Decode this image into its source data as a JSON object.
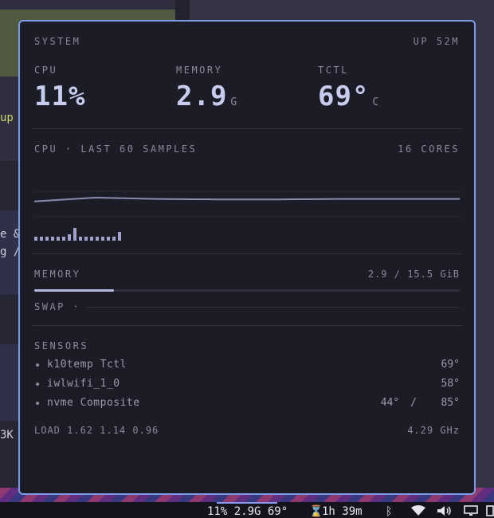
{
  "background": {
    "text_up": "up",
    "text_line1": "e &",
    "text_line2": "g /",
    "text_line3": "3K"
  },
  "statusbar": {
    "system": "11% 2.9G 69°",
    "hourglass_icon": "⌛",
    "time": "1h 39m",
    "bluetooth_icon": "ᛒ",
    "wifi_icon": "▼",
    "volume_icon": "🔊",
    "monitor_icon": "▭",
    "extra": "▯"
  },
  "popup": {
    "title": "SYSTEM",
    "uptime": "UP 52M",
    "stats": [
      {
        "label": "CPU",
        "value": "11%",
        "unit": ""
      },
      {
        "label": "MEMORY",
        "value": "2.9",
        "unit": "G"
      },
      {
        "label": "TCTL",
        "value": "69°",
        "unit": "C"
      }
    ],
    "cpu": {
      "title": "CPU · LAST 60 SAMPLES",
      "cores": "16 CORES",
      "line_samples": [
        0.6,
        0.75,
        0.7,
        0.68,
        0.68,
        0.7,
        0.7,
        0.7
      ],
      "bar_samples": [
        0.3,
        0.3,
        0.3,
        0.3,
        0.3,
        0.3,
        0.45,
        0.9,
        0.3,
        0.3,
        0.3,
        0.3,
        0.3,
        0.3,
        0.3,
        0.6
      ]
    },
    "memory": {
      "title": "MEMORY",
      "usage": "2.9 / 15.5 GiB",
      "fraction": 0.187,
      "swap_label": "SWAP ·"
    },
    "sensors": {
      "title": "SENSORS",
      "items": [
        {
          "name": "k10temp Tctl",
          "value": "69°",
          "max": ""
        },
        {
          "name": "iwlwifi_1_0",
          "value": "58°",
          "max": ""
        },
        {
          "name": "nvme Composite",
          "value": "44°",
          "max": "85°"
        }
      ]
    },
    "footer": {
      "load": "LOAD 1.62 1.14 0.96",
      "freq": "4.29 GHz"
    }
  }
}
